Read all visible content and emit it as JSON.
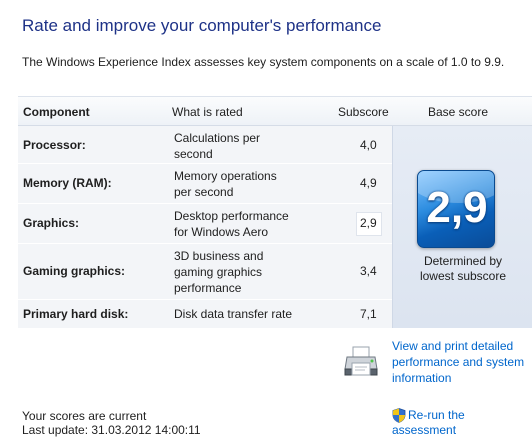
{
  "header": {
    "title": "Rate and improve your computer's performance",
    "description": "The Windows Experience Index assesses key system components on a scale of 1.0 to 9.9."
  },
  "table": {
    "columns": {
      "component": "Component",
      "what": "What is rated",
      "subscore": "Subscore",
      "base": "Base score"
    },
    "rows": [
      {
        "name": "Processor:",
        "what": "Calculations per\nsecond",
        "subscore": "4,0"
      },
      {
        "name": "Memory (RAM):",
        "what": "Memory operations\nper second",
        "subscore": "4,9"
      },
      {
        "name": "Graphics:",
        "what": "Desktop performance\nfor Windows Aero",
        "subscore": "2,9"
      },
      {
        "name": "Gaming graphics:",
        "what": "3D business and\ngaming graphics\nperformance",
        "subscore": "3,4"
      },
      {
        "name": "Primary hard disk:",
        "what": "Disk data transfer rate",
        "subscore": "7,1"
      }
    ]
  },
  "base_score": {
    "value": "2,9",
    "caption": "Determined by\nlowest subscore"
  },
  "actions": {
    "print_link": "View and print detailed performance and system information",
    "rerun": "Re-run the assessment"
  },
  "status": {
    "current": "Your scores are current",
    "last_update": "Last update: 31.03.2012 14:00:11"
  },
  "icons": {
    "printer": "printer-icon",
    "shield": "uac-shield-icon"
  }
}
